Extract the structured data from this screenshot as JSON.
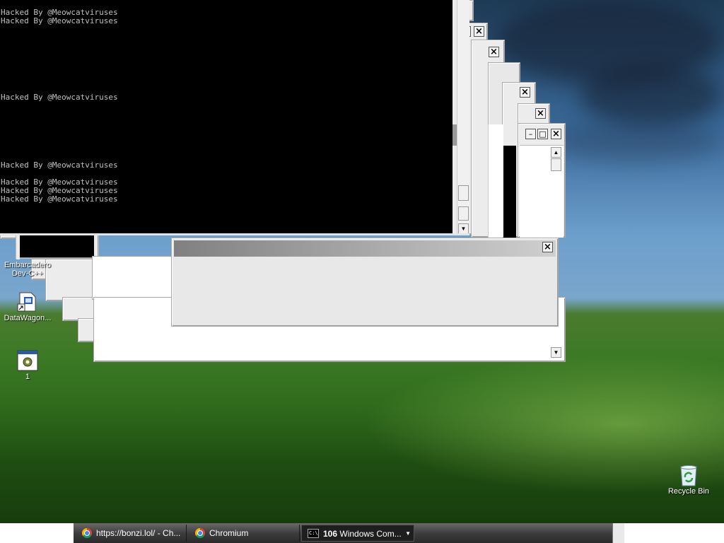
{
  "console": {
    "lines": [
      {
        "text": "Hacked By @Meowcatviruses",
        "row": 0
      },
      {
        "text": "Hacked By @Meowcatviruses",
        "row": 1
      },
      {
        "text": "Hacked By @Meowcatviruses",
        "row": 10
      },
      {
        "text": "Hacked By @Meowcatviruses",
        "row": 18
      },
      {
        "text": "Hacked By @Meowcatviruses",
        "row": 20
      },
      {
        "text": "Hacked By @Meowcatviruses",
        "row": 21
      },
      {
        "text": "Hacked By @Meowcatviruses",
        "row": 22
      }
    ]
  },
  "window_controls": {
    "close": "×",
    "maximize": "□",
    "minimize": "–",
    "scroll_up": "▲",
    "scroll_down": "▼"
  },
  "desktop_icons": [
    {
      "label": "Embarcadero Dev-C++",
      "icon": "devcpp-icon"
    },
    {
      "label": "DataWagon...",
      "icon": "shortcut-file-icon"
    },
    {
      "label": "1",
      "icon": "program-gear-icon"
    },
    {
      "label": "Recycle Bin",
      "icon": "recycle-bin-icon"
    }
  ],
  "taskbar": {
    "buttons": [
      {
        "label": "https://bonzi.lol/ - Ch...",
        "icon": "chromium-icon",
        "active": false
      },
      {
        "label": "Chromium",
        "icon": "chromium-icon",
        "active": false
      },
      {
        "count": "106",
        "label": "Windows Com...",
        "icon": "cmd-icon",
        "active": true
      }
    ]
  }
}
